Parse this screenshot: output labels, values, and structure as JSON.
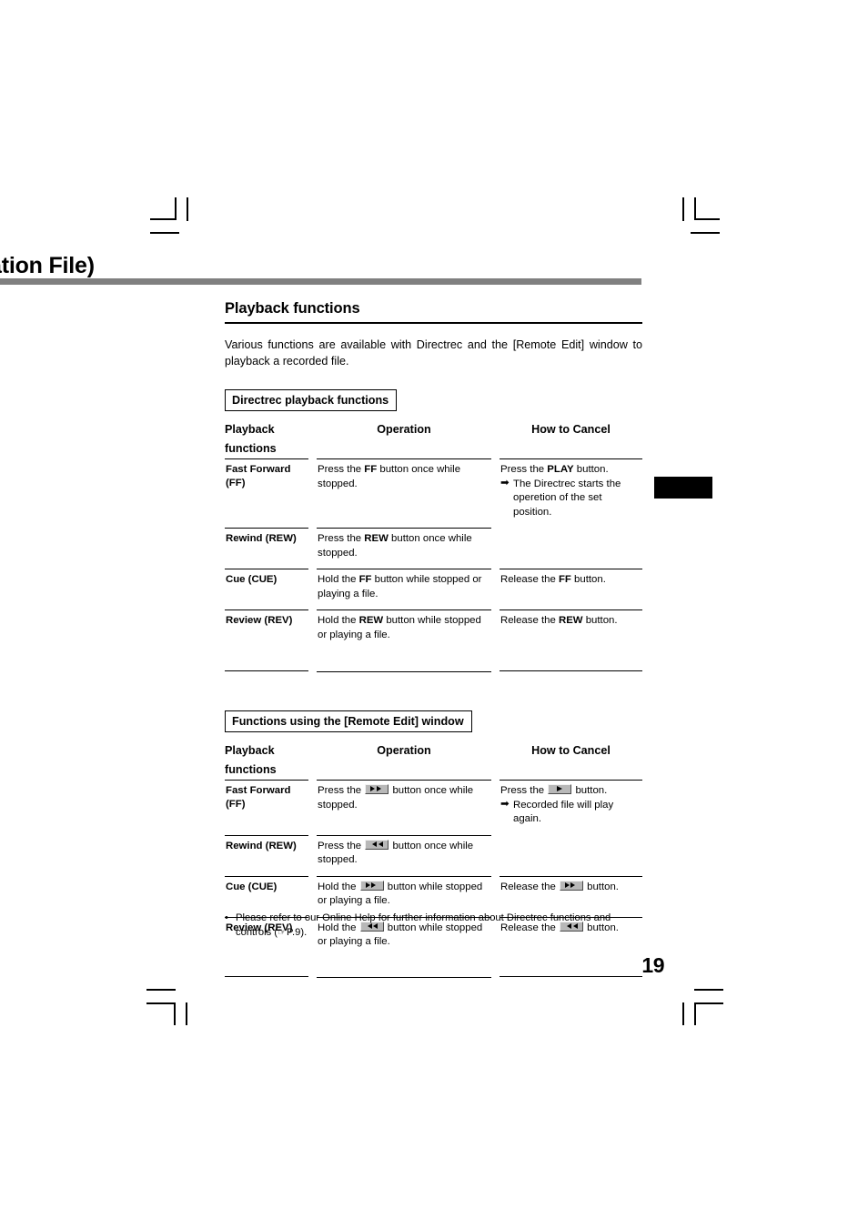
{
  "header": {
    "title": "ation File)",
    "rule_color": "#808080"
  },
  "page_number": "19",
  "section": {
    "heading": "Playback functions",
    "intro": "Various functions are available with Directrec and the [Remote Edit] window to playback a recorded file."
  },
  "table1": {
    "box_title": "Directrec playback functions",
    "columns": {
      "c1_line1": "Playback",
      "c1_line2": "functions",
      "c2": "Operation",
      "c3": "How to Cancel"
    },
    "rows": [
      {
        "fn_line1": "Fast Forward",
        "fn_line2": "(FF)",
        "op_a": "Press the ",
        "op_kw": "FF",
        "op_b": " button once while stopped.",
        "cancel_a": "Press the ",
        "cancel_kw": "PLAY",
        "cancel_b": " button.",
        "cancel_arrow": "➡",
        "cancel_sub": "The Directrec starts the operetion of the set position."
      },
      {
        "fn_line1": "Rewind (REW)",
        "fn_line2": "",
        "op_a": "Press the ",
        "op_kw": "REW",
        "op_b": " button once while stopped.",
        "cancel_a": "",
        "cancel_kw": "",
        "cancel_b": "",
        "cancel_arrow": "",
        "cancel_sub": ""
      },
      {
        "fn_line1": "Cue (CUE)",
        "fn_line2": "",
        "op_a": "Hold the ",
        "op_kw": "FF",
        "op_b": " button while stopped or playing a file.",
        "cancel_a": "Release the ",
        "cancel_kw": "FF",
        "cancel_b": " button.",
        "cancel_arrow": "",
        "cancel_sub": ""
      },
      {
        "fn_line1": "Review (REV)",
        "fn_line2": "",
        "op_a": "Hold the ",
        "op_kw": "REW",
        "op_b": " button while stopped or playing a file.",
        "cancel_a": "Release the ",
        "cancel_kw": "REW",
        "cancel_b": " button.",
        "cancel_arrow": "",
        "cancel_sub": ""
      }
    ]
  },
  "table2": {
    "box_title": "Functions using the [Remote Edit] window",
    "columns": {
      "c1_line1": "Playback",
      "c1_line2": "functions",
      "c2": "Operation",
      "c3": "How to Cancel"
    },
    "rows": [
      {
        "fn_line1": "Fast Forward",
        "fn_line2": "(FF)",
        "op_a": "Press the",
        "op_icon": "fast-forward-button-icon",
        "op_b": "button once while stopped.",
        "cancel_a": "Press the",
        "cancel_icon": "play-button-icon",
        "cancel_b": "button.",
        "cancel_arrow": "➡",
        "cancel_sub": "Recorded file will play again."
      },
      {
        "fn_line1": "Rewind (REW)",
        "fn_line2": "",
        "op_a": "Press the",
        "op_icon": "rewind-button-icon",
        "op_b": "button once while stopped.",
        "cancel_a": "",
        "cancel_icon": "",
        "cancel_b": "",
        "cancel_arrow": "",
        "cancel_sub": ""
      },
      {
        "fn_line1": "Cue (CUE)",
        "fn_line2": "",
        "op_a": "Hold the",
        "op_icon": "fast-forward-button-icon",
        "op_b": "button while stopped or playing a file.",
        "cancel_a": "Release the",
        "cancel_icon": "fast-forward-button-icon",
        "cancel_b": "button.",
        "cancel_arrow": "",
        "cancel_sub": ""
      },
      {
        "fn_line1": "Review (REV)",
        "fn_line2": "",
        "op_a": "Hold the",
        "op_icon": "rewind-button-icon",
        "op_b": "button while stopped or playing a file.",
        "cancel_a": "Release the",
        "cancel_icon": "rewind-button-icon",
        "cancel_b": "button.",
        "cancel_arrow": "",
        "cancel_sub": ""
      }
    ]
  },
  "footnote": {
    "bullet": "•",
    "text": "Please refer to our Online Help for further information about Directrec functions and controls (☞P.9)."
  }
}
